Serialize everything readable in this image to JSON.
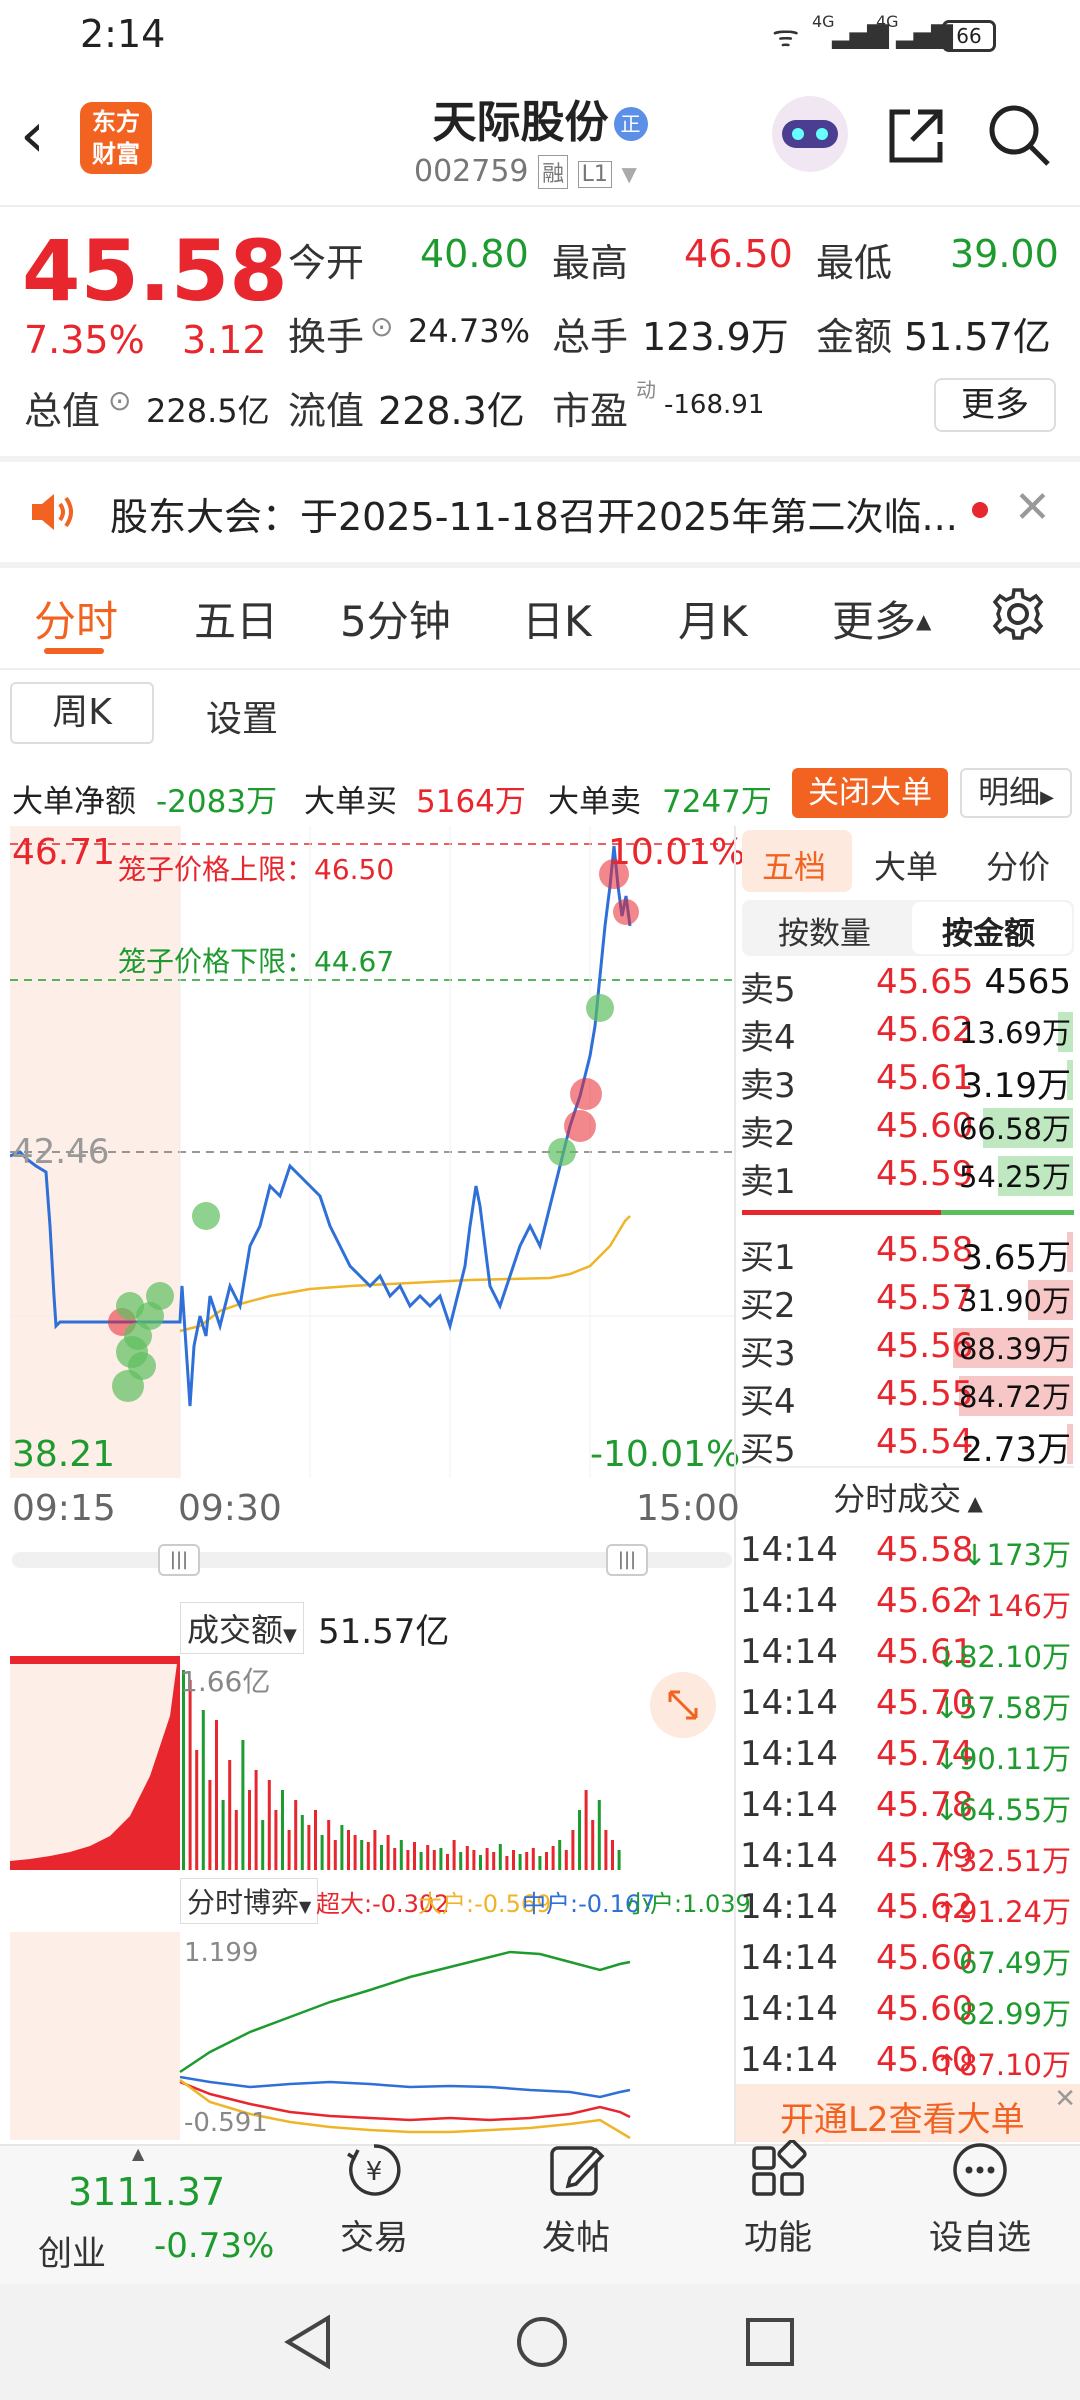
{
  "status_bar": {
    "time": "2:14",
    "signal1": "4G",
    "signal2": "4G",
    "battery": "66"
  },
  "header": {
    "stock_name": "天际股份",
    "stock_badge": "正",
    "stock_code": "002759",
    "tag_margin": "融",
    "tag_level": "L1",
    "logo_line1": "东方",
    "logo_line2": "财富"
  },
  "quote": {
    "price": "45.58",
    "change_pct": "7.35%",
    "change_amt": "3.12",
    "open_label": "今开",
    "open": "40.80",
    "high_label": "最高",
    "high": "46.50",
    "low_label": "最低",
    "low": "39.00",
    "turnover_label": "换手",
    "turnover": "24.73%",
    "volume_label": "总手",
    "volume": "123.9万",
    "amount_label": "金额",
    "amount": "51.57亿",
    "mktcap_label": "总值",
    "mktcap": "228.5亿",
    "float_label": "流值",
    "float": "228.3亿",
    "pe_label": "市盈",
    "pe_sup": "动",
    "pe": "-168.91",
    "more_button": "更多"
  },
  "notice": {
    "text": "股东大会：于2025-11-18召开2025年第二次临..."
  },
  "tabs": [
    "分时",
    "五日",
    "5分钟",
    "日K",
    "月K",
    "更多"
  ],
  "sub_tabs": [
    "周K",
    "设置"
  ],
  "big_orders": {
    "net_label": "大单净额",
    "net": "-2083万",
    "buy_label": "大单买",
    "buy": "5164万",
    "sell_label": "大单卖",
    "sell": "7247万",
    "close_button": "关闭大单",
    "detail_button": "明细"
  },
  "chart": {
    "top_price": "46.71",
    "top_pct": "10.01%",
    "bottom_price": "38.21",
    "bottom_pct": "-10.01%",
    "mid_price": "42.46",
    "upper_limit_label": "笼子价格上限：46.50",
    "lower_limit_label": "笼子价格下限：44.67",
    "time_start": "09:15",
    "time_open": "09:30",
    "time_end": "15:00"
  },
  "volume_panel": {
    "selector": "成交额",
    "value": "51.57亿",
    "max_label": "1.66亿"
  },
  "flow_panel": {
    "selector": "分时博弈",
    "super_label": "超大:-0.302",
    "large_label": "大户:-0.569",
    "mid_label": "中户:-0.167",
    "small_label": "小户:1.039",
    "top_value": "1.199",
    "bottom_value": "-0.591"
  },
  "orderbook": {
    "tabs": [
      "五档",
      "大单",
      "分价"
    ],
    "toggle": [
      "按数量",
      "按金额"
    ],
    "asks": [
      {
        "label": "卖5",
        "price": "45.65",
        "vol": "4565",
        "bar": 0.0
      },
      {
        "label": "卖4",
        "price": "45.62",
        "vol": "13.69万",
        "bar": 0.05
      },
      {
        "label": "卖3",
        "price": "45.61",
        "vol": "3.19万",
        "bar": 0.02
      },
      {
        "label": "卖2",
        "price": "45.60",
        "vol": "66.58万",
        "bar": 0.3
      },
      {
        "label": "卖1",
        "price": "45.59",
        "vol": "54.25万",
        "bar": 0.25
      }
    ],
    "bids": [
      {
        "label": "买1",
        "price": "45.58",
        "vol": "3.65万",
        "bar": 0.02
      },
      {
        "label": "买2",
        "price": "45.57",
        "vol": "31.90万",
        "bar": 0.15
      },
      {
        "label": "买3",
        "price": "45.56",
        "vol": "88.39万",
        "bar": 0.4
      },
      {
        "label": "买4",
        "price": "45.55",
        "vol": "84.72万",
        "bar": 0.38
      },
      {
        "label": "买5",
        "price": "45.54",
        "vol": "2.73万",
        "bar": 0.02
      }
    ]
  },
  "ticks": {
    "title": "分时成交",
    "rows": [
      {
        "time": "14:14",
        "price": "45.58",
        "dir": "↓",
        "vol": "173万",
        "color": "green"
      },
      {
        "time": "14:14",
        "price": "45.62",
        "dir": "↑",
        "vol": "146万",
        "color": "red"
      },
      {
        "time": "14:14",
        "price": "45.61",
        "dir": "↓",
        "vol": "82.10万",
        "color": "green"
      },
      {
        "time": "14:14",
        "price": "45.70",
        "dir": "↓",
        "vol": "57.58万",
        "color": "green"
      },
      {
        "time": "14:14",
        "price": "45.74",
        "dir": "↓",
        "vol": "90.11万",
        "color": "green"
      },
      {
        "time": "14:14",
        "price": "45.78",
        "dir": "↓",
        "vol": "64.55万",
        "color": "green"
      },
      {
        "time": "14:14",
        "price": "45.79",
        "dir": "↑",
        "vol": "32.51万",
        "color": "red"
      },
      {
        "time": "14:14",
        "price": "45.62",
        "dir": "↑",
        "vol": "91.24万",
        "color": "red"
      },
      {
        "time": "14:14",
        "price": "45.60",
        "dir": "",
        "vol": "67.49万",
        "color": "green"
      },
      {
        "time": "14:14",
        "price": "45.60",
        "dir": "",
        "vol": "82.99万",
        "color": "green"
      },
      {
        "time": "14:14",
        "price": "45.60",
        "dir": "↑",
        "vol": "87.10万",
        "color": "red"
      }
    ],
    "promo": "开通L2查看大单"
  },
  "bottom_nav": {
    "index_value": "3111.37",
    "index_name": "创业",
    "index_change": "-0.73%",
    "items": [
      "交易",
      "发帖",
      "功能",
      "设自选"
    ]
  }
}
